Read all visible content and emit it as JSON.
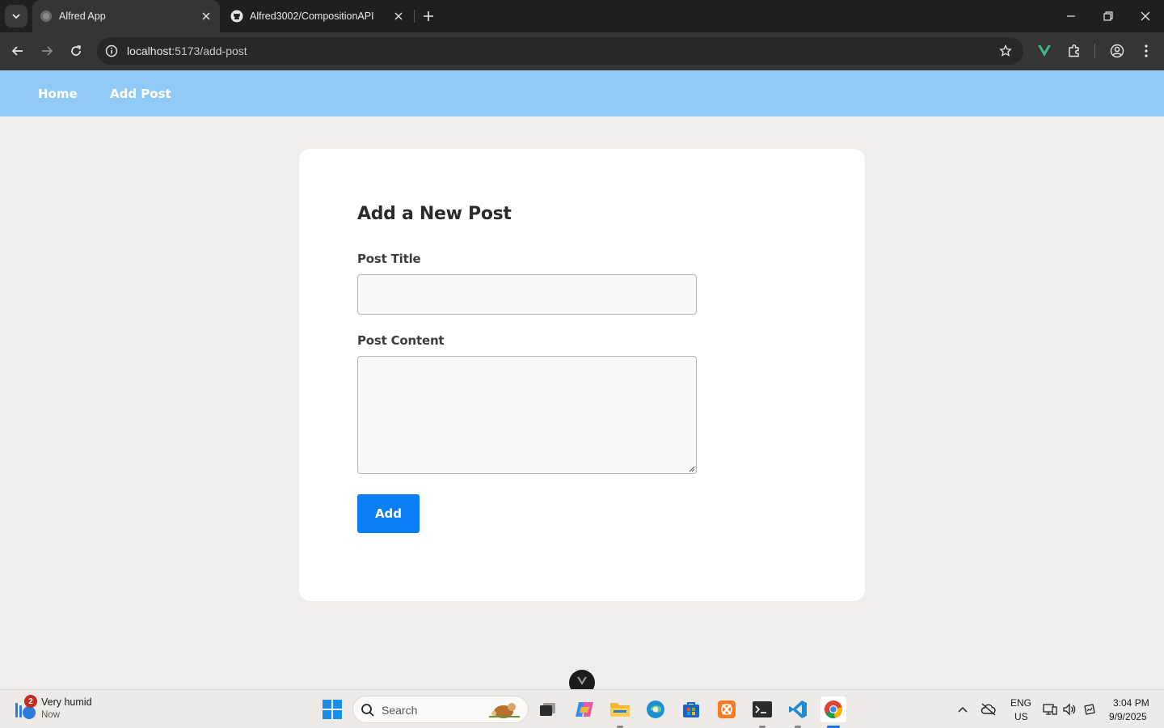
{
  "browser": {
    "tabs": [
      {
        "title": "Alfred App",
        "active": true,
        "favicon": "globe-icon"
      },
      {
        "title": "Alfred3002/CompositionAPI",
        "active": false,
        "favicon": "github-icon"
      }
    ],
    "url_host": "localhost",
    "url_path": ":5173/add-post"
  },
  "app": {
    "nav": [
      {
        "label": "Home"
      },
      {
        "label": "Add Post"
      }
    ],
    "form": {
      "heading": "Add a New Post",
      "title_label": "Post Title",
      "title_value": "",
      "content_label": "Post Content",
      "content_value": "",
      "submit_label": "Add"
    },
    "colors": {
      "nav_bg": "#90c9f6",
      "button_bg": "#0a7ef5",
      "page_bg": "#f1edea"
    }
  },
  "taskbar": {
    "weather": {
      "badge": "2",
      "line1": "Very humid",
      "line2": "Now"
    },
    "search_placeholder": "Search",
    "apps": [
      "windows-start-icon",
      "task-view-icon",
      "copilot-icon",
      "file-explorer-icon",
      "edge-icon",
      "store-icon",
      "xampp-icon",
      "terminal-icon",
      "vscode-icon",
      "chrome-icon"
    ],
    "lang_line1": "ENG",
    "lang_line2": "US",
    "time": "3:04 PM",
    "date": "9/9/2025"
  }
}
